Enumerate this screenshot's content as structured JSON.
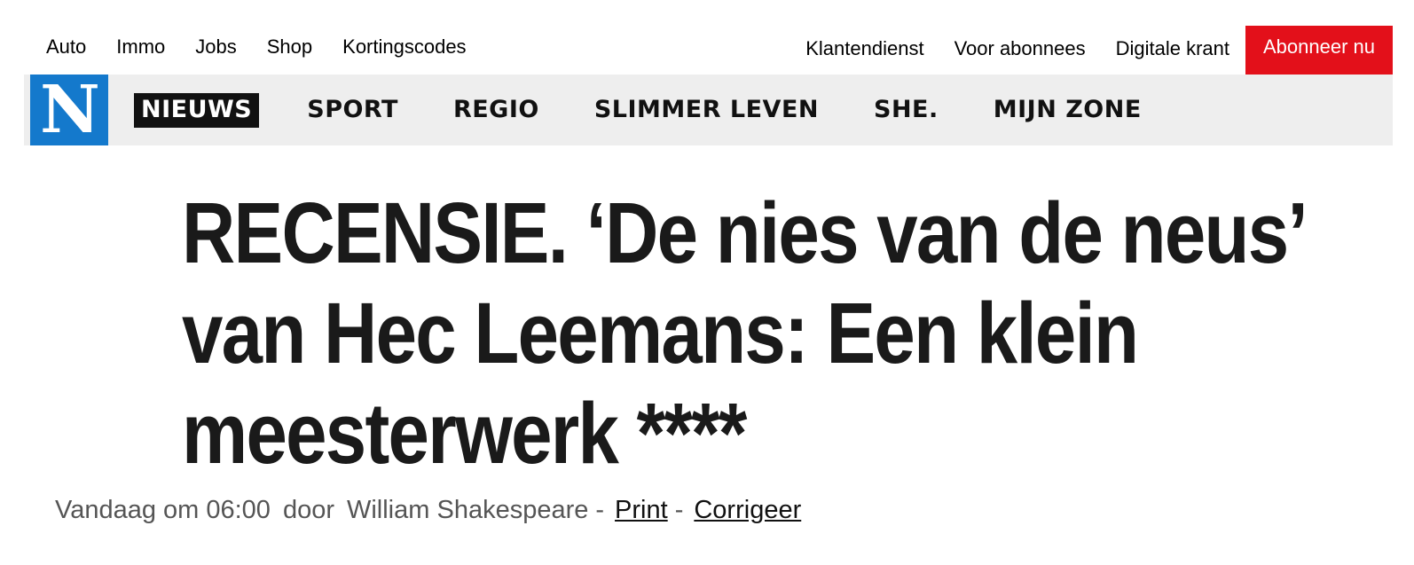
{
  "topbar": {
    "left_links": [
      "Auto",
      "Immo",
      "Jobs",
      "Shop",
      "Kortingscodes"
    ],
    "right_links": [
      "Klantendienst",
      "Voor abonnees",
      "Digitale krant"
    ],
    "subscribe_label": "Abonneer nu"
  },
  "logo": {
    "letter": "N"
  },
  "nav": {
    "items": [
      {
        "label": "NIEUWS",
        "active": true
      },
      {
        "label": "SPORT"
      },
      {
        "label": "REGIO"
      },
      {
        "label": "SLIMMER LEVEN"
      },
      {
        "label": "SHE."
      },
      {
        "label": "MIJN ZONE"
      }
    ]
  },
  "article": {
    "headline": "RECENSIE. ‘De nies van de neus’ van Hec Leemans: Een klein meesterwerk ****",
    "date": "Vandaag om 06:00",
    "by": "door",
    "author": "William Shakespeare",
    "separator": "-",
    "print_label": "Print",
    "correct_label": "Corrigeer"
  },
  "colors": {
    "brand_blue": "#1479cc",
    "subscribe_red": "#e3101a",
    "nav_background": "#eeeeee",
    "active_nav": "#111111"
  }
}
